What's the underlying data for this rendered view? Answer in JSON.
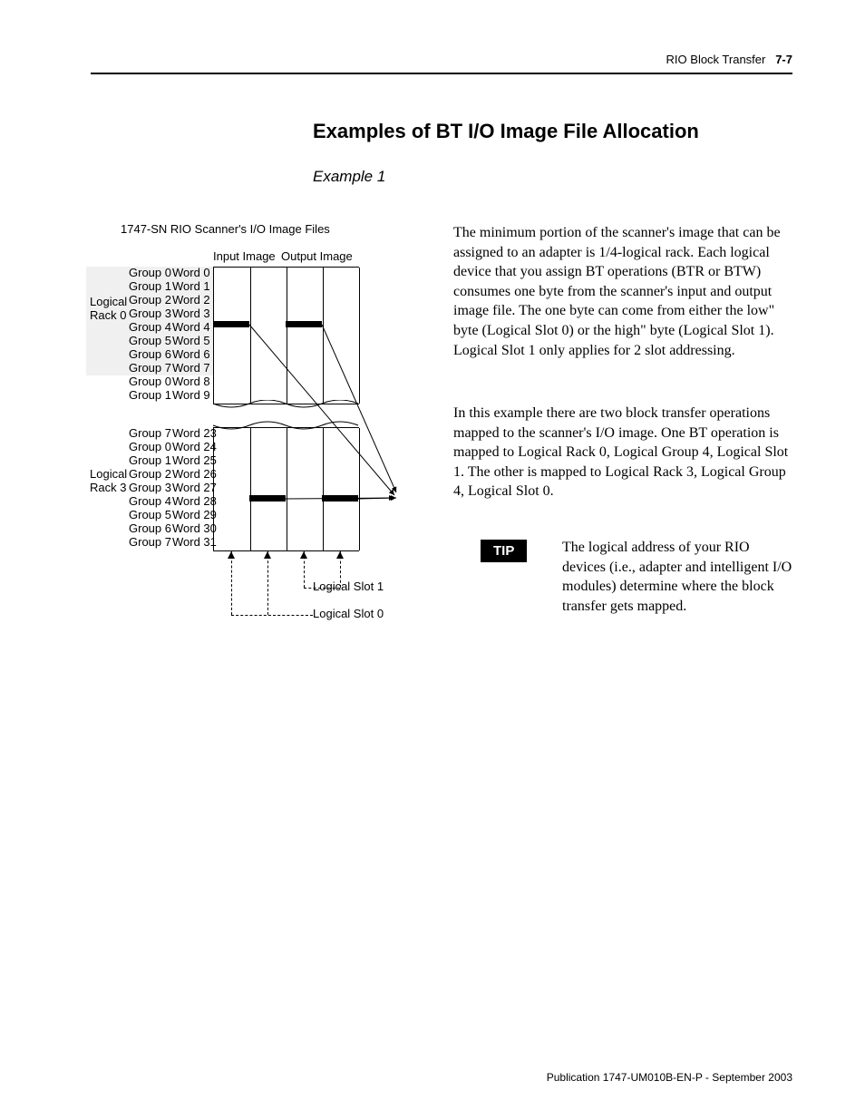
{
  "header": {
    "chapter": "RIO Block Transfer",
    "pagenum": "7-7"
  },
  "section_title": "Examples of BT I/O Image File Allocation",
  "example_label": "Example 1",
  "diagram": {
    "title": "1747-SN RIO Scanner's I/O Image Files",
    "col_input": "Input Image",
    "col_output": "Output Image",
    "rack0_label": "Logical Rack 0",
    "rack3_label": "Logical Rack 3",
    "rack0_rows": [
      {
        "g": "Group 0",
        "w": "Word 0"
      },
      {
        "g": "Group 1",
        "w": "Word 1"
      },
      {
        "g": "Group 2",
        "w": "Word 2"
      },
      {
        "g": "Group 3",
        "w": "Word 3"
      },
      {
        "g": "Group 4",
        "w": "Word 4"
      },
      {
        "g": "Group 5",
        "w": "Word 5"
      },
      {
        "g": "Group 6",
        "w": "Word 6"
      },
      {
        "g": "Group 7",
        "w": "Word 7"
      }
    ],
    "extra_rows": [
      {
        "g": "Group 0",
        "w": "Word 8"
      },
      {
        "g": "Group 1",
        "w": "Word 9"
      }
    ],
    "rack3_first": {
      "g": "Group 7",
      "w": "Word 23"
    },
    "rack3_rows": [
      {
        "g": "Group 0",
        "w": "Word 24"
      },
      {
        "g": "Group 1",
        "w": "Word 25"
      },
      {
        "g": "Group 2",
        "w": "Word 26"
      },
      {
        "g": "Group 3",
        "w": "Word 27"
      },
      {
        "g": "Group 4",
        "w": "Word 28"
      },
      {
        "g": "Group 5",
        "w": "Word 29"
      },
      {
        "g": "Group 6",
        "w": "Word 30"
      },
      {
        "g": "Group 7",
        "w": "Word 31"
      }
    ],
    "slot1": "Logical Slot 1",
    "slot0": "Logical Slot 0"
  },
  "para1": "The minimum portion of the scanner's image that can be assigned to an adapter is 1/4-logical rack. Each logical device that you assign BT operations (BTR or BTW) consumes one byte from the scanner's input and output image file.  The one byte can come from either the low\" byte (Logical Slot 0) or the high\" byte (Logical Slot 1).  Logical Slot 1 only applies for 2 slot addressing.",
  "para2": "In this example there are two block transfer operations mapped to the scanner's I/O image. One BT operation is mapped to Logical Rack 0, Logical Group 4, Logical Slot 1.  The other is mapped to Logical Rack 3, Logical Group 4, Logical Slot 0.",
  "tip_label": "TIP",
  "tip_text": "The logical address of your RIO devices (i.e., adapter and intelligent I/O modules) determine where the block transfer gets mapped.",
  "footer": "Publication 1747-UM010B-EN-P - September 2003"
}
